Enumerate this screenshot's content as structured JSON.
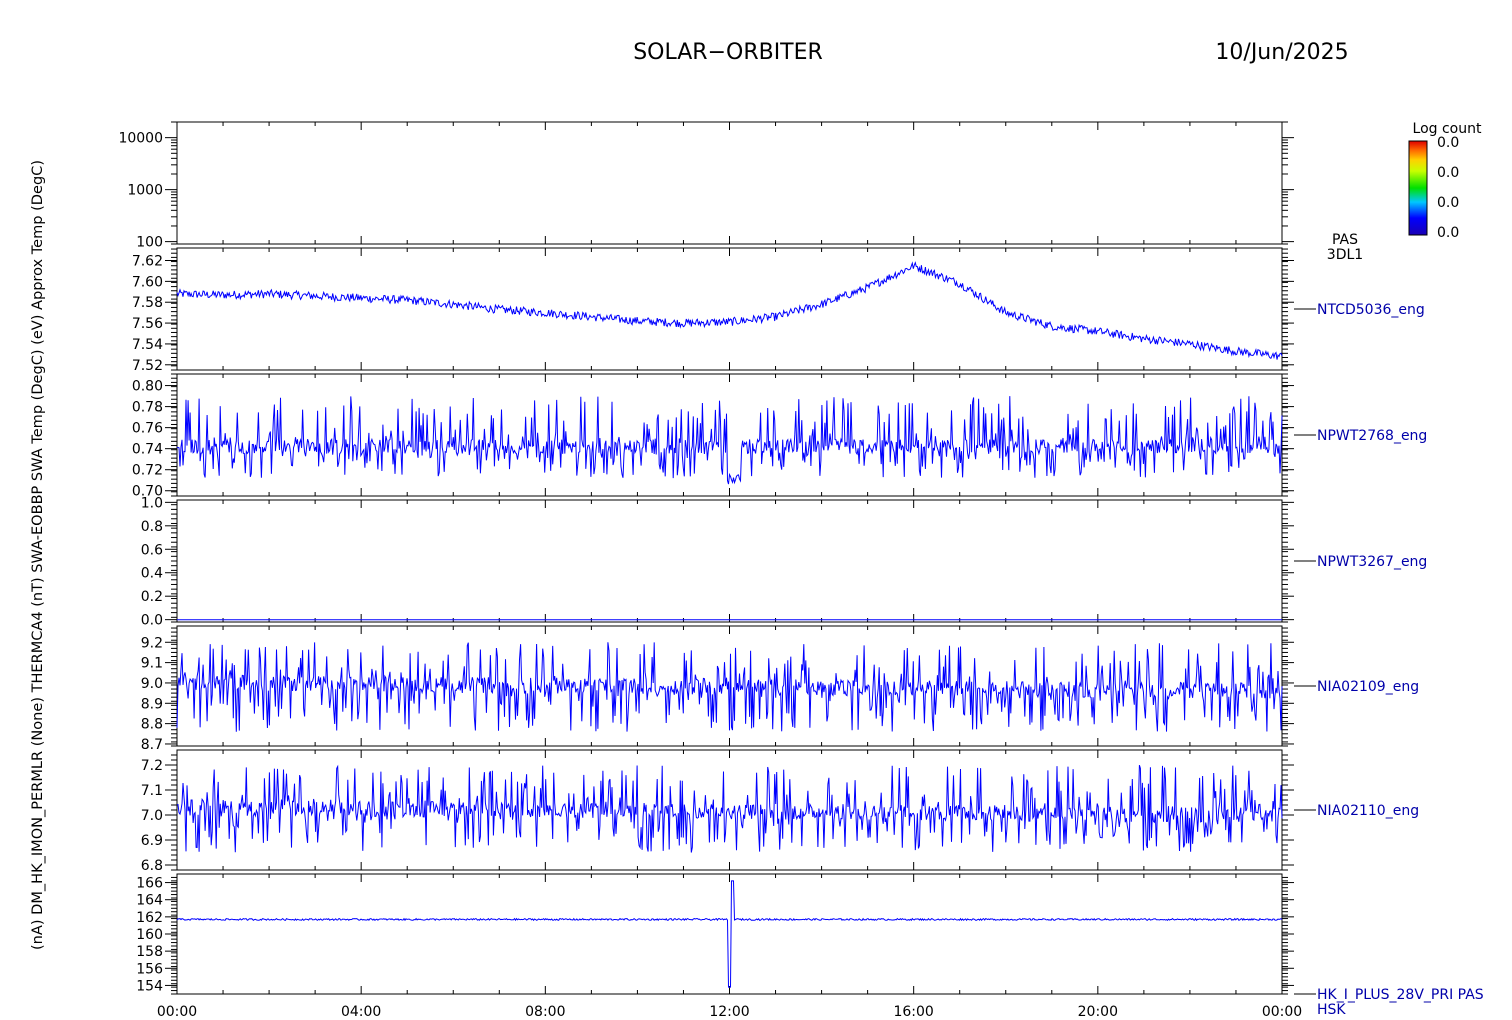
{
  "header": {
    "mission": "SOLAR−ORBITER",
    "date": "10/Jun/2025"
  },
  "left_label": "(nA) DM_HK_IMON_PERMLR (None) THERMCA4 (nT) SWA-EOBBP SWA Temp (DegC) (eV) Approx Temp (DegC)",
  "colorbar": {
    "title": "Log count",
    "ticks": [
      "0.0",
      "0.0",
      "0.0",
      "0.0"
    ]
  },
  "colors": {
    "trace": "#0000ff",
    "label": "#0000aa",
    "axis": "#000000"
  },
  "chart_data": [
    {
      "type": "heatmap",
      "panel": "energy spectrogram",
      "side_label": [
        "PAS",
        "3DL1"
      ],
      "yscale": "log",
      "ylim": [
        90,
        20000
      ],
      "ytick_labels": [
        "10000",
        "1000",
        "100"
      ],
      "ytick_values": [
        10000,
        1000,
        100
      ],
      "values": []
    },
    {
      "type": "line",
      "side_label": [
        "NTCD5036_eng"
      ],
      "ylim": [
        7.515,
        7.632
      ],
      "ytick_labels": [
        "7.62",
        "7.60",
        "7.58",
        "7.56",
        "7.54",
        "7.52"
      ],
      "ytick_values": [
        7.62,
        7.6,
        7.58,
        7.56,
        7.54,
        7.52
      ],
      "x_hours": [
        0,
        1,
        2,
        3,
        4,
        5,
        6,
        7,
        8,
        9,
        10,
        11,
        12,
        13,
        14,
        15,
        16,
        17,
        18,
        19,
        20,
        21,
        22,
        23,
        24
      ],
      "values": [
        7.588,
        7.587,
        7.588,
        7.586,
        7.584,
        7.582,
        7.578,
        7.573,
        7.57,
        7.566,
        7.562,
        7.56,
        7.561,
        7.566,
        7.578,
        7.594,
        7.615,
        7.598,
        7.57,
        7.557,
        7.552,
        7.545,
        7.54,
        7.533,
        7.528
      ],
      "noise": 0.004
    },
    {
      "type": "line",
      "side_label": [
        "NPWT2768_eng"
      ],
      "ylim": [
        0.695,
        0.811
      ],
      "ytick_labels": [
        "0.80",
        "0.78",
        "0.76",
        "0.74",
        "0.72",
        "0.70"
      ],
      "ytick_values": [
        0.8,
        0.78,
        0.76,
        0.74,
        0.72,
        0.7
      ],
      "x_hours": [
        0,
        24
      ],
      "values": [
        0.742,
        0.742
      ],
      "band": [
        0.712,
        0.79
      ],
      "dip": {
        "hour": 12.1,
        "value": 0.706
      }
    },
    {
      "type": "line",
      "side_label": [
        "NPWT3267_eng"
      ],
      "ylim": [
        -0.02,
        1.02
      ],
      "ytick_labels": [
        "1.0",
        "0.8",
        "0.6",
        "0.4",
        "0.2",
        "0.0"
      ],
      "ytick_values": [
        1.0,
        0.8,
        0.6,
        0.4,
        0.2,
        0.0
      ],
      "x_hours": [
        0,
        24
      ],
      "values": [
        0.0,
        0.0
      ]
    },
    {
      "type": "line",
      "side_label": [
        "NIA02109_eng"
      ],
      "ylim": [
        8.69,
        9.28
      ],
      "ytick_labels": [
        "9.2",
        "9.1",
        "9.0",
        "8.9",
        "8.8",
        "8.7"
      ],
      "ytick_values": [
        9.2,
        9.1,
        9.0,
        8.9,
        8.8,
        8.7
      ],
      "x_hours": [
        0,
        24
      ],
      "values": [
        9.0,
        8.96
      ],
      "band": [
        8.76,
        9.2
      ]
    },
    {
      "type": "line",
      "side_label": [
        "NIA02110_eng"
      ],
      "ylim": [
        6.78,
        7.26
      ],
      "ytick_labels": [
        "7.2",
        "7.1",
        "7.0",
        "6.9",
        "6.8"
      ],
      "ytick_values": [
        7.2,
        7.1,
        7.0,
        6.9,
        6.8
      ],
      "x_hours": [
        0,
        24
      ],
      "values": [
        7.03,
        7.0
      ],
      "band": [
        6.85,
        7.2
      ]
    },
    {
      "type": "line",
      "side_label": [
        "HK_I_PLUS_28V_PRI PAS",
        "HSK"
      ],
      "ylim": [
        153,
        167
      ],
      "ytick_labels": [
        "166",
        "164",
        "162",
        "160",
        "158",
        "156",
        "154"
      ],
      "ytick_values": [
        166,
        164,
        162,
        160,
        158,
        156,
        154
      ],
      "x_hours": [
        0,
        24
      ],
      "values": [
        161.7,
        161.7
      ],
      "spike": {
        "hour": 12.0,
        "low": 153.8,
        "high": 166.2
      }
    }
  ],
  "x_axis": {
    "range_hours": [
      0,
      24
    ],
    "tick_labels": [
      "00:00",
      "04:00",
      "08:00",
      "12:00",
      "16:00",
      "20:00",
      "00:00"
    ],
    "tick_hours": [
      0,
      4,
      8,
      12,
      16,
      20,
      24
    ]
  }
}
